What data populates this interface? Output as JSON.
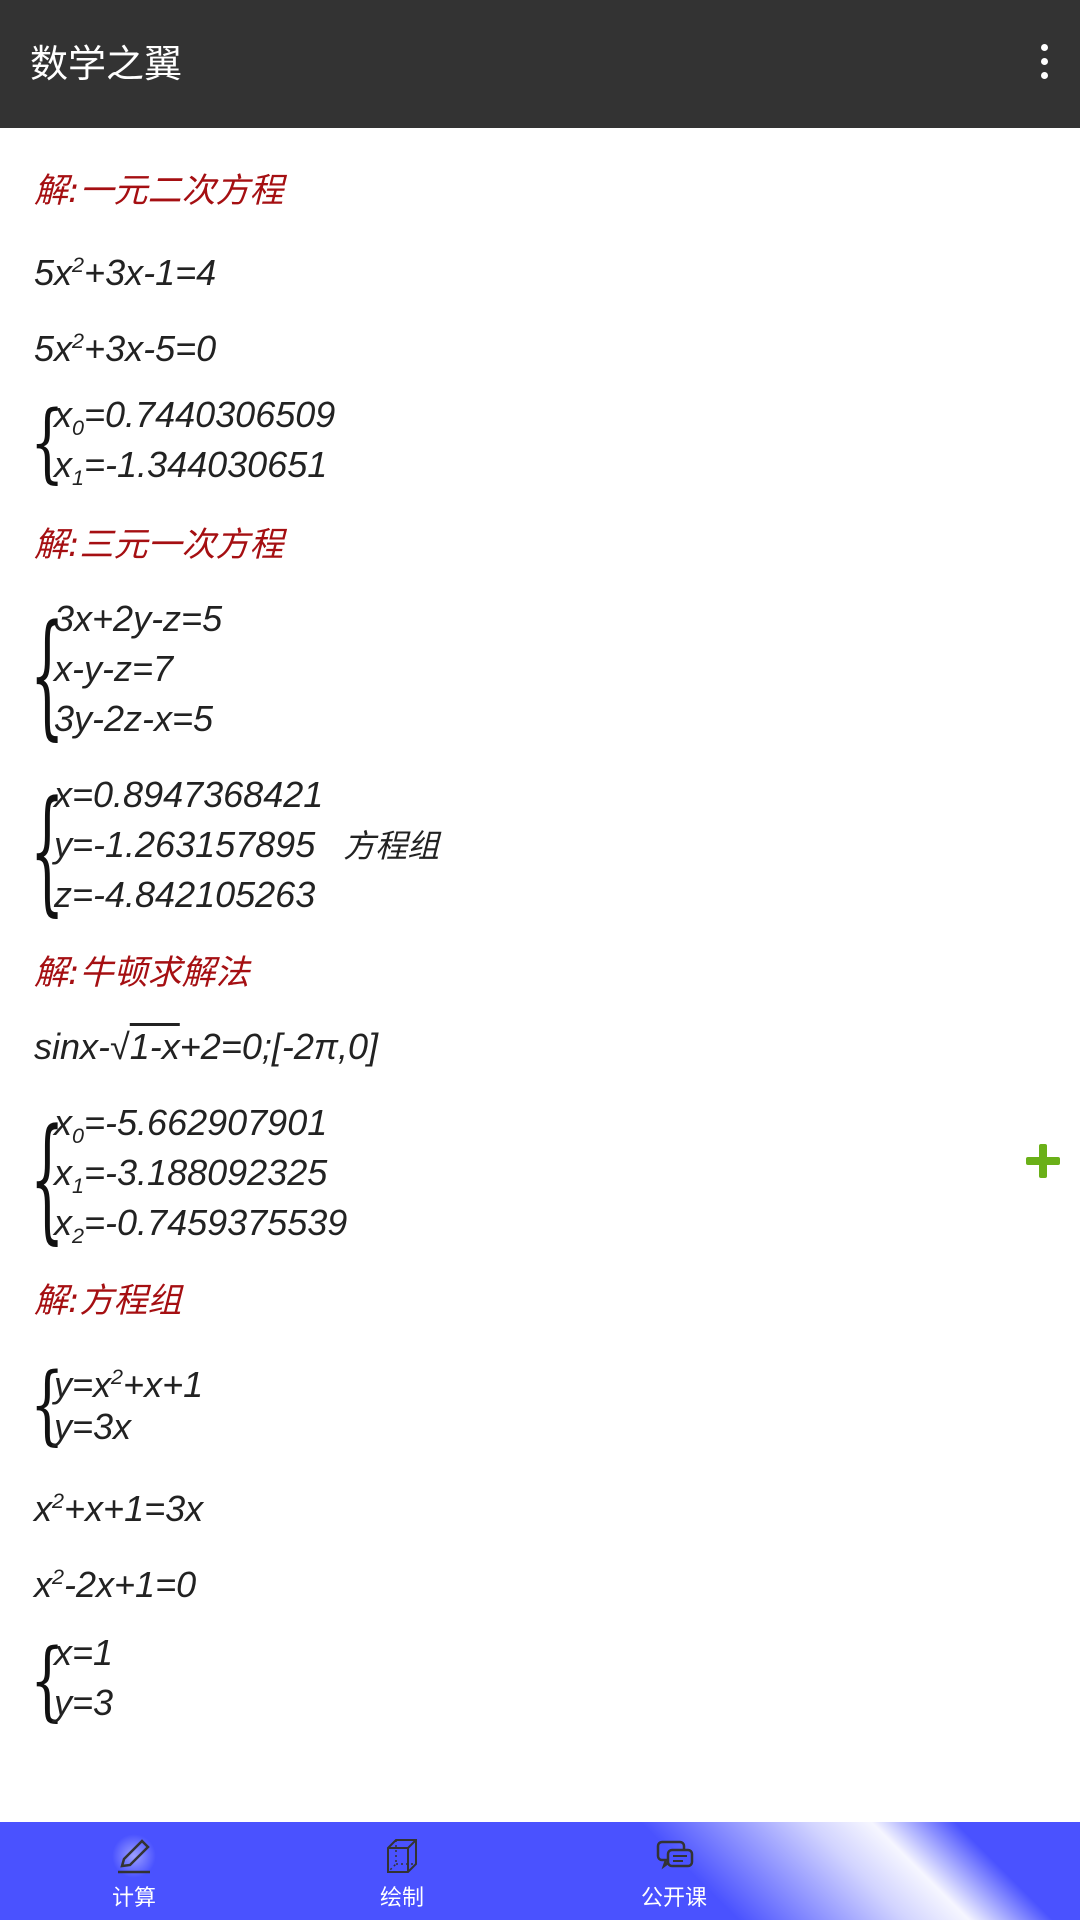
{
  "app": {
    "title": "数学之翼"
  },
  "colors": {
    "appbar": "#333333",
    "heading": "#a50f12",
    "bottom_bar": "#4a52ff",
    "add_icon": "#6ab018"
  },
  "sections": {
    "quadratic": {
      "heading": "解:一元二次方程",
      "l1a": "5x",
      "l1b": "2",
      "l1c": "+3x-1=4",
      "l2a": "5x",
      "l2b": "2",
      "l2c": "+3x-5=0",
      "r1a": "x",
      "r1b": "0",
      "r1c": "=0.7440306509",
      "r2a": "x",
      "r2b": "1",
      "r2c": "=-1.344030651"
    },
    "linear3": {
      "heading": "解:三元一次方程",
      "e1": "3x+2y-z=5",
      "e2": "x-y-z=7",
      "e3": "3y-2z-x=5",
      "s1": "x=0.8947368421",
      "s2": "y=-1.263157895",
      "s2note": "方程组",
      "s3": "z=-4.842105263"
    },
    "newton": {
      "heading": "解:牛顿求解法",
      "eq_a": "sinx-√",
      "eq_b": "1-x",
      "eq_c": "+2=0;[-2π,0]",
      "r1a": "x",
      "r1b": "0",
      "r1c": "=-5.662907901",
      "r2a": "x",
      "r2b": "1",
      "r2c": "=-3.188092325",
      "r3a": "x",
      "r3b": "2",
      "r3c": "=-0.7459375539"
    },
    "system": {
      "heading": "解:方程组",
      "s1a": "y=x",
      "s1b": "2",
      "s1c": "+x+1",
      "s2": "y=3x",
      "l1a": "x",
      "l1b": "2",
      "l1c": "+x+1=3x",
      "l2a": "x",
      "l2b": "2",
      "l2c": "-2x+1=0",
      "r1": "x=1",
      "r2": "y=3"
    }
  },
  "bottom_nav": [
    {
      "label": "计算",
      "icon": "pencil-icon",
      "active": true
    },
    {
      "label": "绘制",
      "icon": "cube-icon",
      "active": false
    },
    {
      "label": "公开课",
      "icon": "chat-icon",
      "active": false
    }
  ]
}
